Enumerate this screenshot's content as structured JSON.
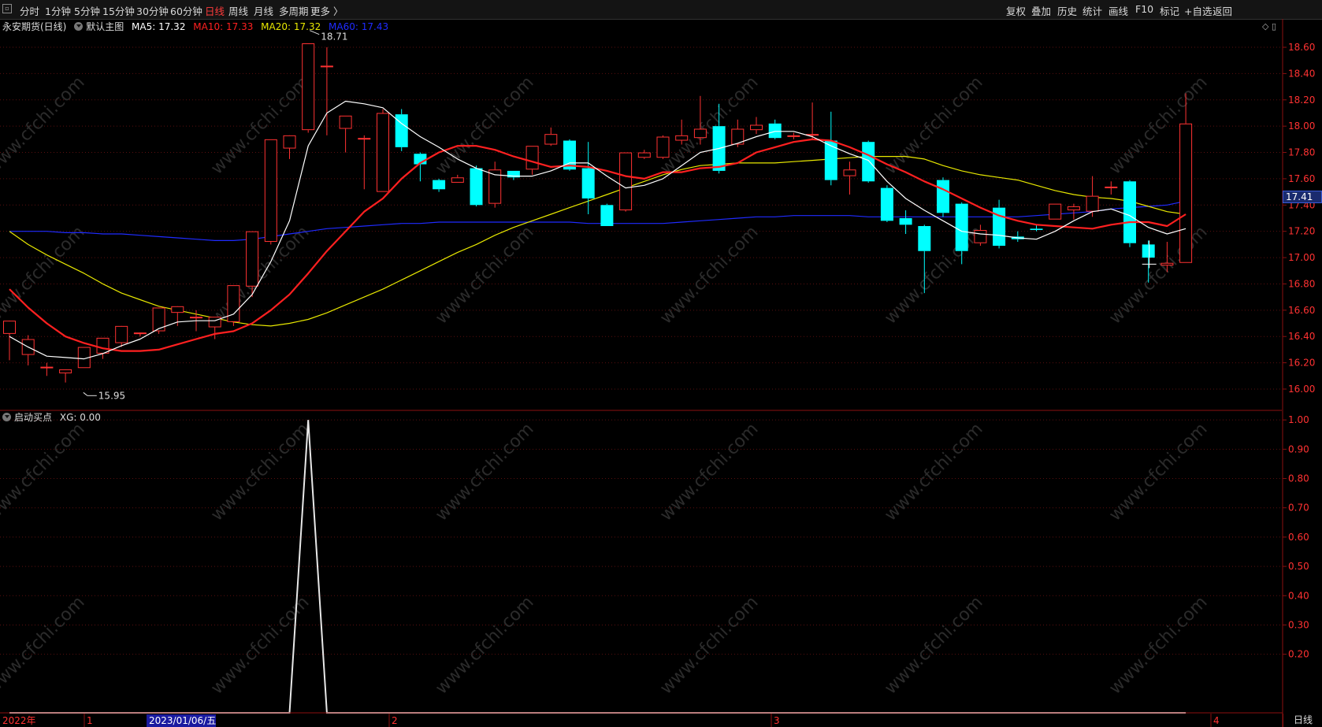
{
  "toolbar": {
    "left_items": [
      "分时",
      "1分钟",
      "5分钟",
      "15分钟",
      "30分钟",
      "60分钟",
      "日线",
      "周线",
      "月线",
      "多周期",
      "更多 〉"
    ],
    "active_item": "日线",
    "right_items": [
      "复权",
      "叠加",
      "历史",
      "统计",
      "画线",
      "F10",
      "标记",
      "+自选",
      "返回"
    ]
  },
  "main_pane": {
    "title": "永安期货(日线)",
    "template": "默认主图",
    "ma5": "MA5: 17.32",
    "ma10": "MA10: 17.33",
    "ma20": "MA20: 17.32",
    "ma60": "MA60: 17.43",
    "high_label": "18.71",
    "low_label": "15.95",
    "current_price": "17.41",
    "y_ticks": [
      "18.60",
      "18.40",
      "18.20",
      "18.00",
      "17.80",
      "17.60",
      "17.40",
      "17.20",
      "17.00",
      "16.80",
      "16.60",
      "16.40",
      "16.20",
      "16.00"
    ]
  },
  "sub_pane": {
    "title": "启动买点",
    "xg": "XG: 0.00",
    "y_ticks": [
      "1.00",
      "0.90",
      "0.80",
      "0.70",
      "0.60",
      "0.50",
      "0.40",
      "0.30",
      "0.20"
    ]
  },
  "x_axis": {
    "year_label": "2022年",
    "cursor_date": "2023/01/06/五",
    "month_labels": [
      "1",
      "2",
      "3",
      "4"
    ],
    "period_tab": "日线"
  },
  "watermark": "www.cfchi.com",
  "colors": {
    "up": "#ff3232",
    "down": "#00ffff",
    "ma5": "#ffffff",
    "ma10": "#ff2020",
    "ma20": "#e8e800",
    "ma60": "#1f2bff",
    "grid": "#5a0f0f",
    "axis": "#8b1010"
  },
  "chart_data": {
    "type": "candlestick",
    "symbol": "永安期货",
    "period": "日线",
    "ohlc": [
      [
        16.42,
        16.52,
        16.22,
        16.22
      ],
      [
        16.26,
        16.38,
        16.18,
        16.41
      ],
      [
        16.17,
        16.17,
        16.1,
        16.2
      ],
      [
        16.12,
        16.15,
        16.05,
        16.13
      ],
      [
        16.16,
        16.32,
        16.16,
        16.32
      ],
      [
        16.27,
        16.39,
        16.23,
        16.39
      ],
      [
        16.35,
        16.48,
        16.32,
        16.47
      ],
      [
        16.42,
        16.43,
        16.41,
        16.4
      ],
      [
        16.44,
        16.62,
        16.42,
        16.62
      ],
      [
        16.58,
        16.63,
        16.48,
        16.62
      ],
      [
        16.55,
        16.55,
        16.44,
        16.6
      ],
      [
        16.47,
        16.55,
        16.38,
        16.55
      ],
      [
        16.51,
        16.79,
        16.48,
        16.79
      ],
      [
        16.78,
        17.2,
        16.7,
        17.2
      ],
      [
        17.12,
        17.9,
        17.1,
        17.9
      ],
      [
        17.83,
        17.93,
        17.75,
        17.92
      ],
      [
        17.97,
        18.63,
        17.95,
        18.63
      ],
      [
        18.46,
        18.46,
        17.93,
        18.6
      ],
      [
        17.98,
        18.08,
        17.8,
        18.08
      ],
      [
        17.91,
        17.91,
        17.52,
        17.93
      ],
      [
        17.5,
        18.1,
        17.5,
        18.13
      ],
      [
        18.09,
        17.84,
        17.81,
        18.13
      ],
      [
        17.79,
        17.71,
        17.58,
        17.8
      ],
      [
        17.59,
        17.52,
        17.5,
        17.6
      ],
      [
        17.57,
        17.61,
        17.57,
        17.63
      ],
      [
        17.68,
        17.4,
        17.39,
        17.7
      ],
      [
        17.41,
        17.67,
        17.38,
        17.73
      ],
      [
        17.66,
        17.61,
        17.59,
        17.66
      ],
      [
        17.67,
        17.85,
        17.63,
        17.85
      ],
      [
        17.86,
        17.94,
        17.85,
        17.99
      ],
      [
        17.89,
        17.67,
        17.66,
        17.9
      ],
      [
        17.68,
        17.45,
        17.33,
        17.88
      ],
      [
        17.4,
        17.24,
        17.24,
        17.41
      ],
      [
        17.36,
        17.8,
        17.35,
        17.8
      ],
      [
        17.76,
        17.8,
        17.75,
        17.82
      ],
      [
        17.76,
        17.92,
        17.75,
        17.93
      ],
      [
        17.89,
        17.93,
        17.86,
        18.05
      ],
      [
        17.91,
        17.98,
        17.86,
        18.23
      ],
      [
        18.0,
        17.66,
        17.64,
        18.17
      ],
      [
        17.86,
        17.98,
        17.84,
        18.05
      ],
      [
        17.97,
        18.01,
        17.94,
        18.07
      ],
      [
        18.02,
        17.91,
        17.9,
        18.05
      ],
      [
        17.92,
        17.93,
        17.9,
        17.95
      ],
      [
        17.93,
        17.94,
        17.9,
        18.18
      ],
      [
        17.89,
        17.59,
        17.55,
        18.11
      ],
      [
        17.62,
        17.67,
        17.48,
        17.73
      ],
      [
        17.88,
        17.58,
        17.57,
        17.89
      ],
      [
        17.53,
        17.28,
        17.27,
        17.55
      ],
      [
        17.3,
        17.25,
        17.18,
        17.36
      ],
      [
        17.24,
        17.05,
        16.73,
        17.25
      ],
      [
        17.59,
        17.34,
        17.31,
        17.61
      ],
      [
        17.41,
        17.05,
        16.95,
        17.42
      ],
      [
        17.11,
        17.21,
        17.09,
        17.25
      ],
      [
        17.38,
        17.09,
        17.07,
        17.44
      ],
      [
        17.16,
        17.14,
        17.12,
        17.2
      ],
      [
        17.22,
        17.21,
        17.2,
        17.25
      ],
      [
        17.29,
        17.41,
        17.29,
        17.41
      ],
      [
        17.36,
        17.39,
        17.29,
        17.41
      ],
      [
        17.35,
        17.47,
        17.31,
        17.62
      ],
      [
        17.53,
        17.54,
        17.48,
        17.58
      ],
      [
        17.58,
        17.11,
        17.08,
        17.59
      ],
      [
        17.1,
        17.0,
        16.81,
        17.13
      ],
      [
        16.94,
        16.96,
        16.89,
        17.12
      ],
      [
        16.96,
        18.02,
        16.96,
        18.25
      ]
    ],
    "ma5": [
      16.4,
      16.32,
      16.25,
      16.24,
      16.23,
      16.27,
      16.33,
      16.38,
      16.46,
      16.51,
      16.52,
      16.52,
      16.57,
      16.72,
      16.97,
      17.28,
      17.85,
      18.1,
      18.19,
      18.17,
      18.14,
      18.02,
      17.92,
      17.84,
      17.75,
      17.68,
      17.63,
      17.62,
      17.62,
      17.66,
      17.72,
      17.72,
      17.62,
      17.53,
      17.55,
      17.6,
      17.7,
      17.8,
      17.83,
      17.87,
      17.92,
      17.96,
      17.96,
      17.92,
      17.85,
      17.79,
      17.74,
      17.58,
      17.45,
      17.36,
      17.28,
      17.2,
      17.18,
      17.17,
      17.15,
      17.14,
      17.2,
      17.28,
      17.35,
      17.37,
      17.32,
      17.23,
      17.18,
      17.22
    ],
    "ma10": [
      16.76,
      16.62,
      16.5,
      16.4,
      16.35,
      16.31,
      16.29,
      16.29,
      16.3,
      16.34,
      16.38,
      16.42,
      16.44,
      16.5,
      16.6,
      16.72,
      16.88,
      17.05,
      17.2,
      17.35,
      17.45,
      17.6,
      17.72,
      17.8,
      17.85,
      17.85,
      17.82,
      17.77,
      17.73,
      17.69,
      17.7,
      17.69,
      17.66,
      17.62,
      17.6,
      17.65,
      17.65,
      17.68,
      17.69,
      17.72,
      17.8,
      17.84,
      17.88,
      17.9,
      17.89,
      17.84,
      17.78,
      17.71,
      17.65,
      17.58,
      17.52,
      17.45,
      17.38,
      17.32,
      17.28,
      17.25,
      17.24,
      17.23,
      17.22,
      17.25,
      17.27,
      17.27,
      17.24,
      17.33
    ],
    "ma20": [
      17.2,
      17.1,
      17.02,
      16.95,
      16.88,
      16.8,
      16.73,
      16.68,
      16.63,
      16.6,
      16.57,
      16.54,
      16.51,
      16.49,
      16.48,
      16.5,
      16.53,
      16.58,
      16.64,
      16.7,
      16.76,
      16.83,
      16.9,
      16.97,
      17.04,
      17.1,
      17.17,
      17.23,
      17.28,
      17.33,
      17.38,
      17.43,
      17.48,
      17.53,
      17.58,
      17.63,
      17.67,
      17.7,
      17.71,
      17.72,
      17.72,
      17.72,
      17.73,
      17.74,
      17.75,
      17.76,
      17.77,
      17.77,
      17.77,
      17.75,
      17.7,
      17.66,
      17.63,
      17.61,
      17.59,
      17.55,
      17.51,
      17.48,
      17.46,
      17.45,
      17.43,
      17.39,
      17.35,
      17.33
    ],
    "ma60": [
      17.2,
      17.2,
      17.2,
      17.19,
      17.19,
      17.18,
      17.18,
      17.17,
      17.16,
      17.15,
      17.14,
      17.13,
      17.13,
      17.14,
      17.16,
      17.18,
      17.2,
      17.22,
      17.23,
      17.24,
      17.25,
      17.26,
      17.26,
      17.27,
      17.27,
      17.27,
      17.27,
      17.27,
      17.27,
      17.27,
      17.27,
      17.26,
      17.26,
      17.26,
      17.26,
      17.26,
      17.27,
      17.28,
      17.29,
      17.3,
      17.31,
      17.31,
      17.32,
      17.32,
      17.32,
      17.32,
      17.31,
      17.31,
      17.31,
      17.31,
      17.31,
      17.31,
      17.31,
      17.31,
      17.31,
      17.32,
      17.33,
      17.34,
      17.35,
      17.37,
      17.38,
      17.39,
      17.4,
      17.43
    ],
    "xg": [
      0,
      0,
      0,
      0,
      0,
      0,
      0,
      0,
      0,
      0,
      0,
      0,
      0,
      0,
      0,
      0,
      1,
      0,
      0,
      0,
      0,
      0,
      0,
      0,
      0,
      0,
      0,
      0,
      0,
      0,
      0,
      0,
      0,
      0,
      0,
      0,
      0,
      0,
      0,
      0,
      0,
      0,
      0,
      0,
      0,
      0,
      0,
      0,
      0,
      0,
      0,
      0,
      0,
      0,
      0,
      0,
      0,
      0,
      0,
      0,
      0,
      0,
      0,
      0
    ],
    "main_ylim": [
      15.85,
      18.72
    ],
    "sub_ylim": [
      0,
      1.03
    ]
  }
}
